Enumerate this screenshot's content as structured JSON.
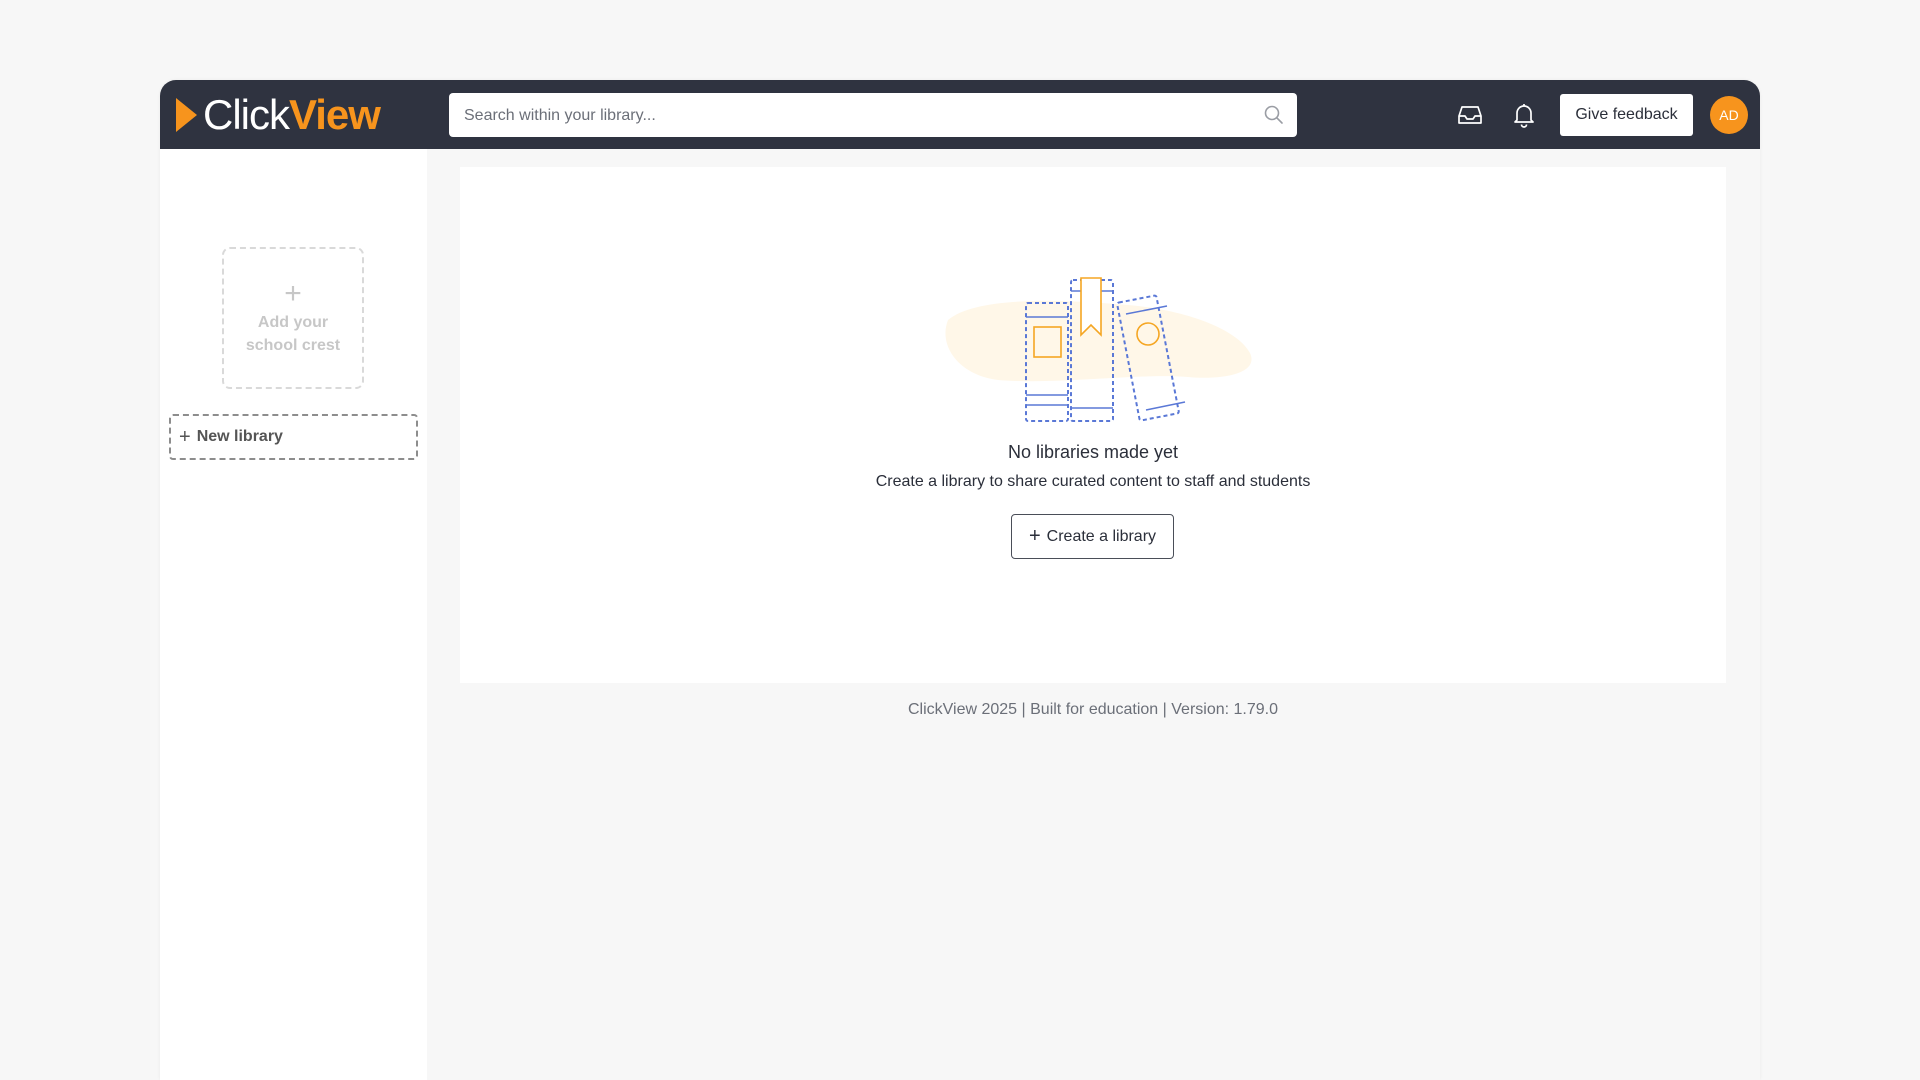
{
  "header": {
    "logo_word1": "Click",
    "logo_word2": "View",
    "search_placeholder": "Search within your library...",
    "feedback_label": "Give feedback",
    "avatar_initials": "AD",
    "icons": [
      "search-icon",
      "inbox-icon",
      "bell-icon"
    ]
  },
  "sidebar": {
    "crest_plus": "+",
    "crest_text_line1": "Add your",
    "crest_text_line2": "school crest",
    "new_library_plus": "+",
    "new_library_label": "New library"
  },
  "empty_state": {
    "title": "No libraries made yet",
    "subtitle": "Create a library to share curated content to staff and students",
    "create_plus": "+",
    "create_label": "Create a library"
  },
  "footer": {
    "text": "ClickView 2025 | Built for education | Version: 1.79.0"
  },
  "colors": {
    "topbar": "#2f3340",
    "brand_orange": "#f7941d",
    "illustration_blue": "#5a78d6",
    "page_bg": "#f7f7f7"
  }
}
